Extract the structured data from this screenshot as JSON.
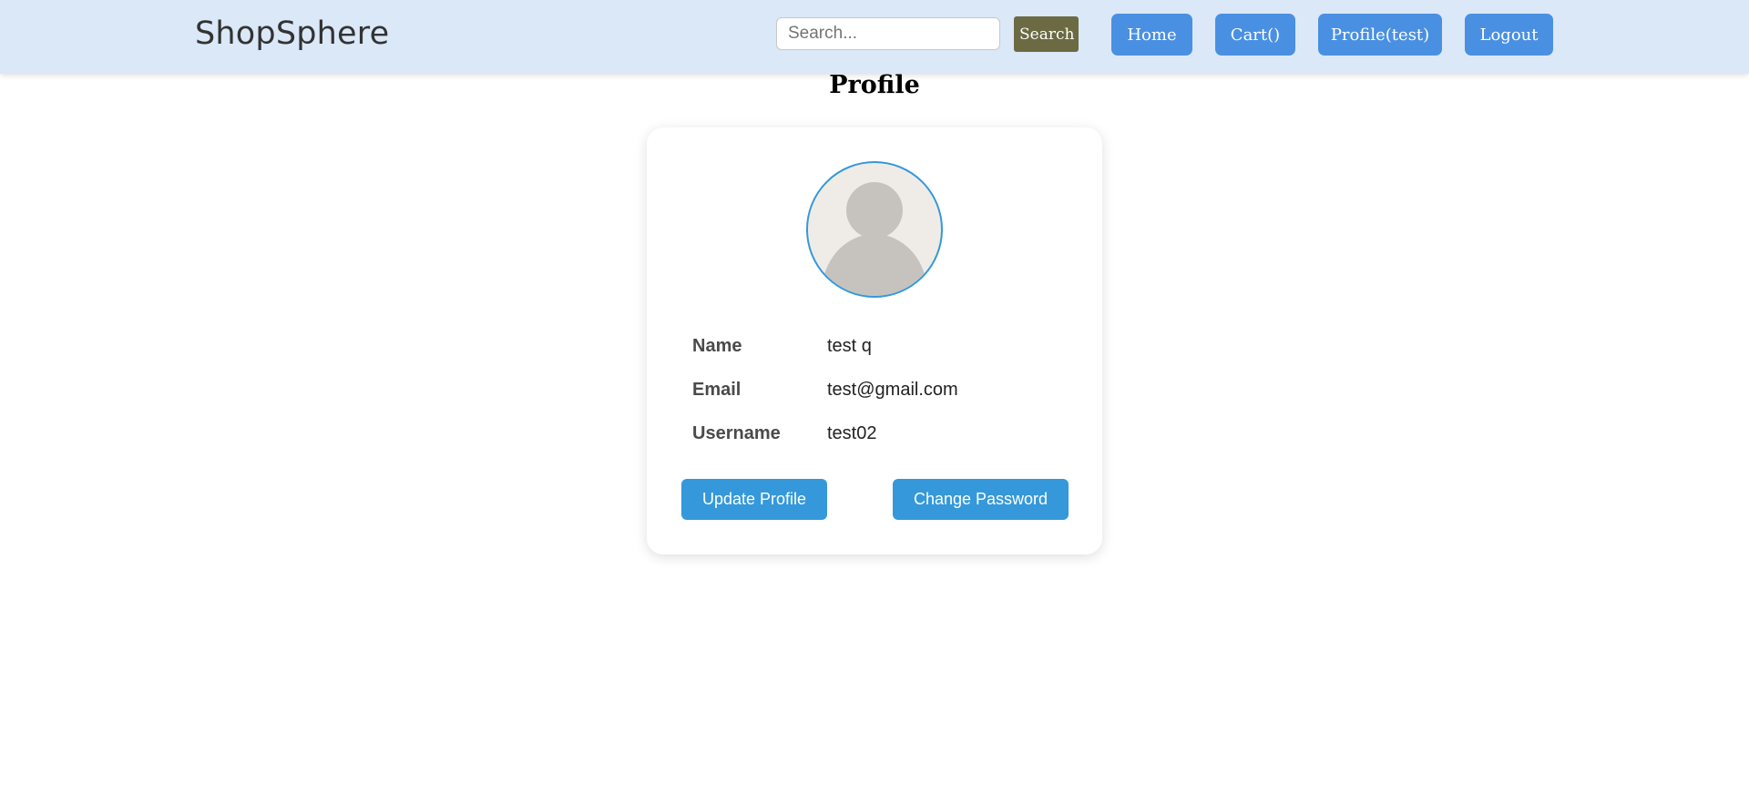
{
  "header": {
    "brand": "ShopSphere",
    "search_placeholder": "Search...",
    "search_value": "",
    "search_button": "Search",
    "nav": {
      "home": "Home",
      "cart": "Cart()",
      "profile": "Profile(test)",
      "logout": "Logout"
    }
  },
  "main": {
    "title": "Profile",
    "avatar_icon": "user-placeholder-icon",
    "fields": {
      "name_label": "Name",
      "name_value": "test q",
      "email_label": "Email",
      "email_value": "test@gmail.com",
      "username_label": "Username",
      "username_value": "test02"
    },
    "actions": {
      "update": "Update Profile",
      "change_password": "Change Password"
    }
  },
  "colors": {
    "navbar_bg": "#dbe8f8",
    "nav_button": "#4a90e2",
    "search_button": "#6b6a42",
    "primary_button": "#3498db",
    "avatar_border": "#3498db"
  }
}
